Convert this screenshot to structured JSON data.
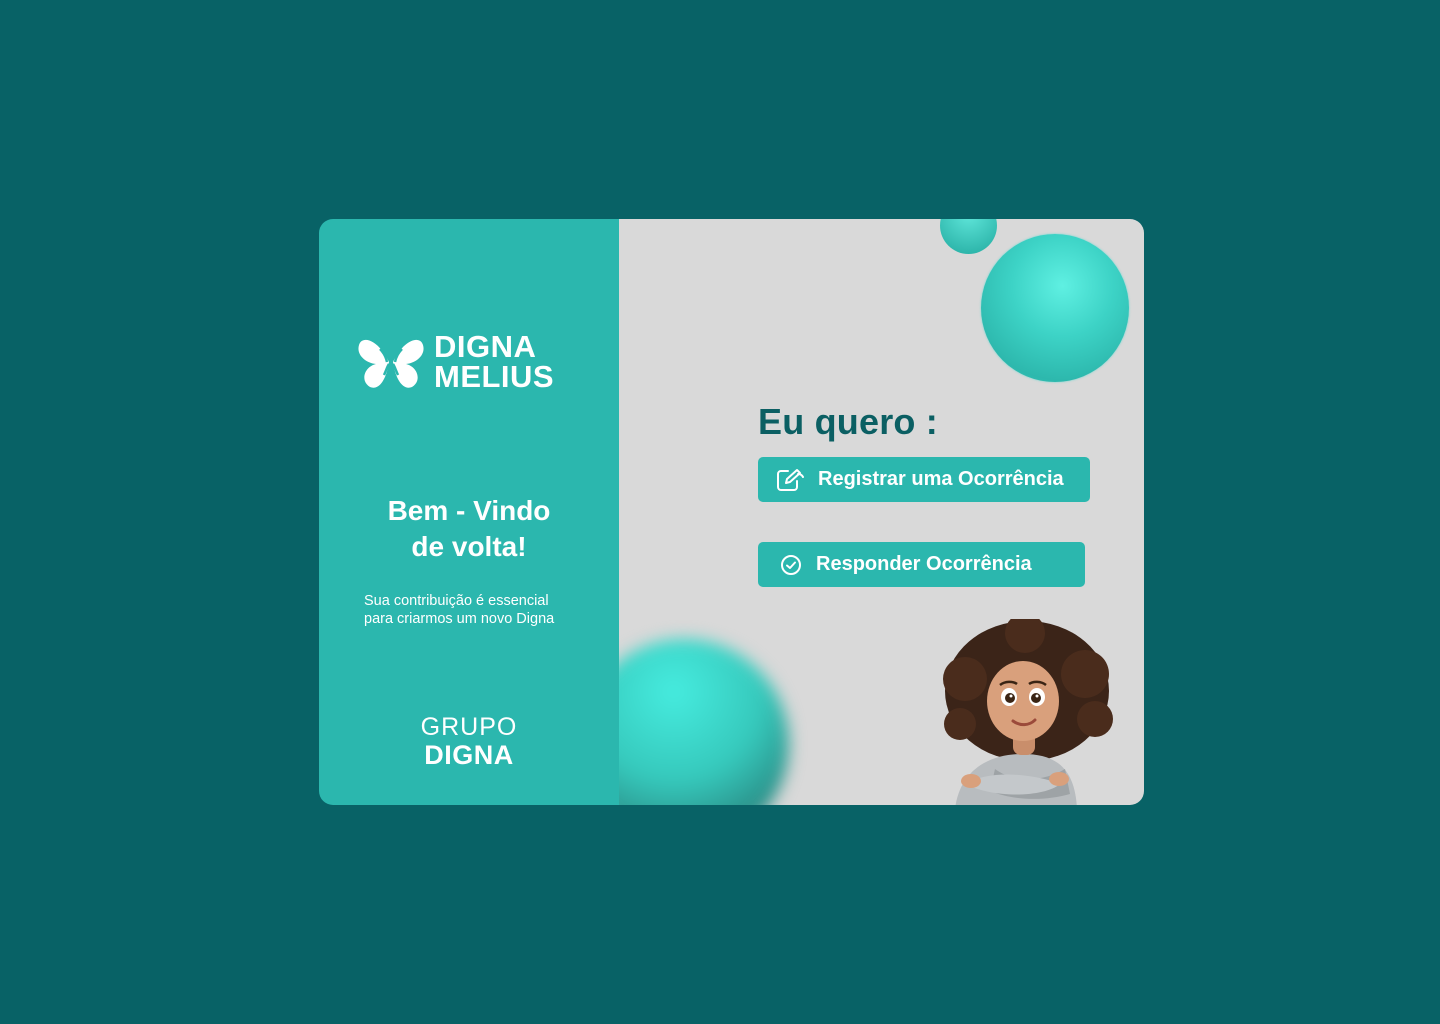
{
  "brand": {
    "logo_line1": "DIGNA",
    "logo_line2": "MELIUS",
    "logo_icon": "butterfly-icon",
    "group_line1": "GRUPO",
    "group_line2": "DIGNA"
  },
  "welcome": {
    "line1": "Bem - Vindo",
    "line2": "de volta!",
    "subtitle_line1": "Sua contribuição é essencial",
    "subtitle_line2": "para criarmos um novo Digna"
  },
  "actions": {
    "heading": "Eu quero :",
    "register": {
      "label": "Registrar uma Ocorrência",
      "icon": "edit-icon"
    },
    "respond": {
      "label": "Responder Ocorrência",
      "icon": "check-circle-icon"
    }
  },
  "colors": {
    "background": "#086266",
    "panel_teal": "#2bb7ae",
    "panel_gray": "#d9d9d9",
    "heading": "#0b5f63",
    "text_on_teal": "#ffffff"
  }
}
